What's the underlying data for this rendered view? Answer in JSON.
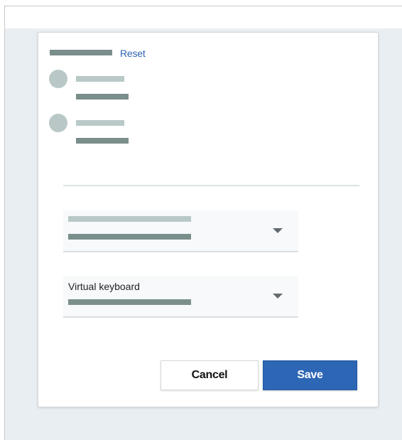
{
  "dialog": {
    "reset_label": "Reset",
    "dropdowns": [
      {
        "label": ""
      },
      {
        "label": "Virtual keyboard"
      }
    ],
    "cancel_label": "Cancel",
    "save_label": "Save"
  },
  "colors": {
    "accent": "#2d66b5",
    "link": "#2f63b4",
    "backdrop": "#e9eef2"
  },
  "icons": {
    "dropdown_arrow": "chevron-down-icon"
  }
}
